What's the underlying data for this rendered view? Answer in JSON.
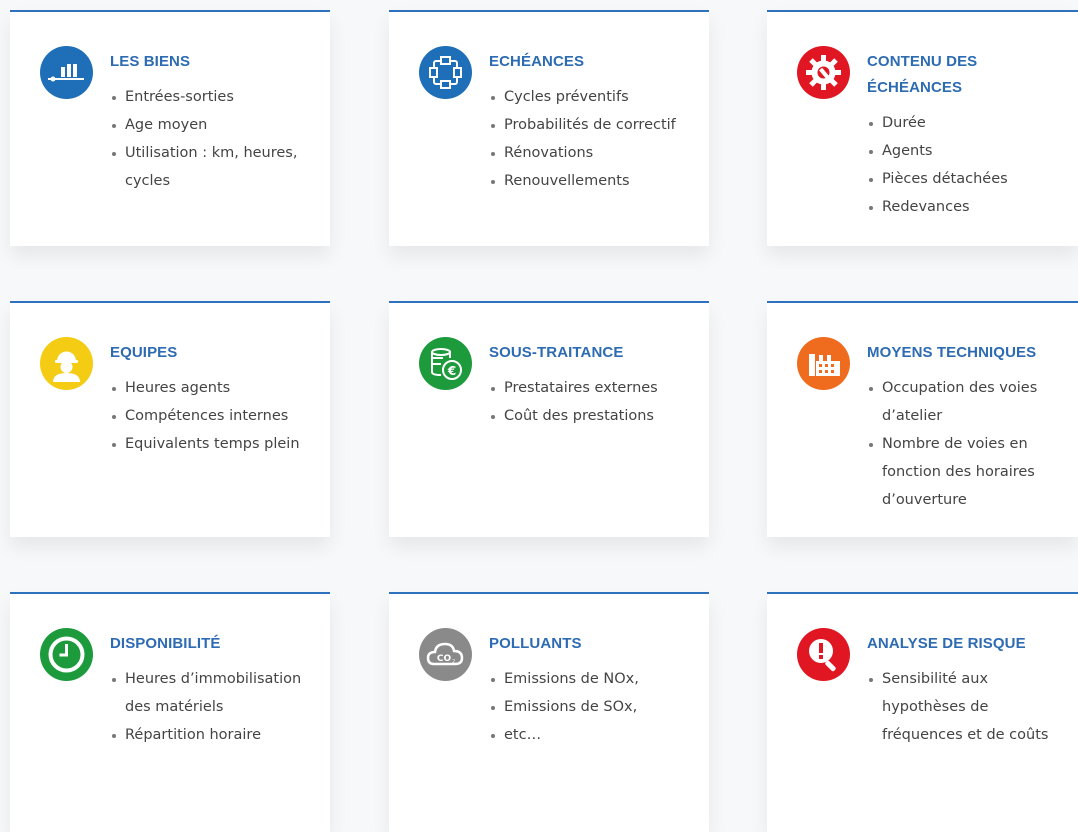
{
  "cards": [
    {
      "title": "LES BIENS",
      "icon": "bar-chart-icon",
      "color": "#1f6fb8",
      "items": [
        "Entrées-sorties",
        "Age moyen",
        "Utilisation : km, heures, cycles"
      ]
    },
    {
      "title": "ECHÉANCES",
      "icon": "cycle-icon",
      "color": "#1f6fb8",
      "items": [
        "Cycles préventifs",
        "Probabilités de correctif",
        "Rénovations",
        "Renouvellements"
      ]
    },
    {
      "title": "CONTENU DES ÉCHÉANCES",
      "icon": "gear-wrench-icon",
      "color": "#e01623",
      "items": [
        "Durée",
        "Agents",
        "Pièces détachées",
        "Redevances"
      ]
    },
    {
      "title": "EQUIPES",
      "icon": "worker-icon",
      "color": "#f4cc14",
      "items": [
        "Heures agents",
        "Compétences internes",
        "Equivalents temps plein"
      ]
    },
    {
      "title": "SOUS-TRAITANCE",
      "icon": "euro-coins-icon",
      "color": "#1d9a3c",
      "items": [
        "Prestataires externes",
        "Coût des prestations"
      ]
    },
    {
      "title": "MOYENS TECHNIQUES",
      "icon": "factory-icon",
      "color": "#ef6c1f",
      "items": [
        "Occupation des voies d’atelier",
        "Nombre de voies en fonction des horaires d’ouverture"
      ]
    },
    {
      "title": "DISPONIBILITÉ",
      "icon": "clock-icon",
      "color": "#1d9a3c",
      "items": [
        "Heures d’immobilisation des matériels",
        "Répartition horaire"
      ]
    },
    {
      "title": "POLLUANTS",
      "icon": "co2-cloud-icon",
      "color": "#8a8a8a",
      "items": [
        "Emissions de NOx,",
        "Emissions de SOx,",
        "etc…"
      ]
    },
    {
      "title": "ANALYSE DE RISQUE",
      "icon": "risk-magnifier-icon",
      "color": "#e01623",
      "items": [
        "Sensibilité aux hypothèses de fréquences et de coûts"
      ]
    }
  ]
}
